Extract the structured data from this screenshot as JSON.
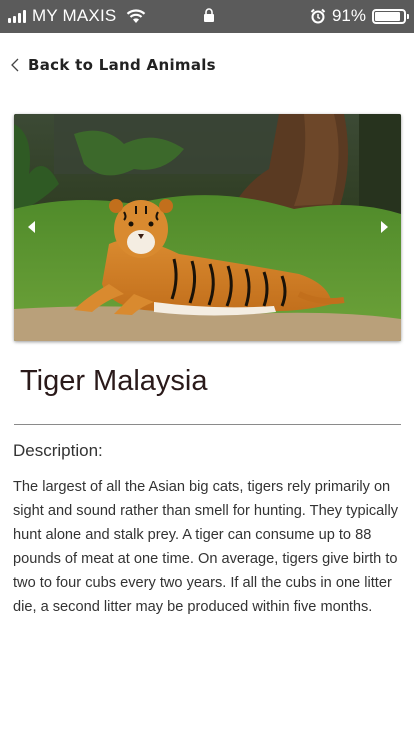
{
  "status_bar": {
    "carrier": "MY MAXIS",
    "battery_percent": "91%",
    "battery_level": 0.91,
    "icons": [
      "signal-icon",
      "wifi-icon",
      "lock-icon",
      "alarm-icon",
      "battery-icon"
    ]
  },
  "nav": {
    "back_label": "Back to Land Animals"
  },
  "hero": {
    "image_alt": "Tiger lying on grass",
    "prev_icon": "chevron-left-icon",
    "next_icon": "chevron-right-icon"
  },
  "animal": {
    "name": "Tiger Malaysia",
    "description_label": "Description:",
    "description": "The largest of all the Asian big cats, tigers rely primarily on sight and sound rather than smell for hunting. They typically hunt alone and stalk prey. A tiger can consume up to 88 pounds of meat at one time. On average, tigers give birth to two to four cubs every two years. If all the cubs in one litter die, a second litter may be produced within five months."
  },
  "colors": {
    "status_bar_bg": "#5b5b5b",
    "text_primary": "#333333",
    "title": "#2a1a1a",
    "divider": "#8a8a8a"
  }
}
